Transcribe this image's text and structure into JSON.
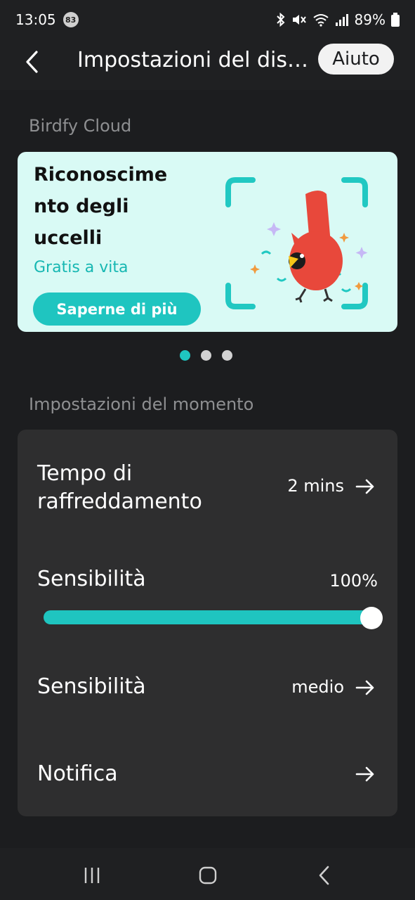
{
  "status_bar": {
    "time": "13:05",
    "notification_count": "83",
    "battery": "89%"
  },
  "header": {
    "title": "Impostazioni del dis…",
    "help_label": "Aiuto"
  },
  "cloud_section": {
    "label": "Birdfy Cloud",
    "banner": {
      "title_line1": "Riconoscime",
      "title_line2": "nto degli",
      "title_line3": "uccelli",
      "subtitle": "Gratis a vita",
      "button_label": "Saperne di più"
    },
    "carousel": {
      "pages": 3,
      "active_index": 0
    }
  },
  "moment_section": {
    "label": "Impostazioni del momento",
    "rows": [
      {
        "label_line1": "Tempo di",
        "label_line2": "raffreddamento",
        "value": "2 mins"
      },
      {
        "label": "Sensibilità",
        "value": "100%",
        "slider_fraction": 1.0
      },
      {
        "label": "Sensibilità",
        "value": "medio"
      },
      {
        "label": "Notifica",
        "value": ""
      }
    ]
  },
  "colors": {
    "accent": "#1fc5c0",
    "background": "#1c1d1f",
    "card": "#2e2e2f",
    "banner": "#d9faf5"
  },
  "icons": [
    "back-arrow-icon",
    "right-arrow-icon",
    "bluetooth-icon",
    "mute-icon",
    "wifi-icon",
    "signal-icon",
    "battery-icon",
    "recents-icon",
    "home-icon",
    "nav-back-icon"
  ]
}
